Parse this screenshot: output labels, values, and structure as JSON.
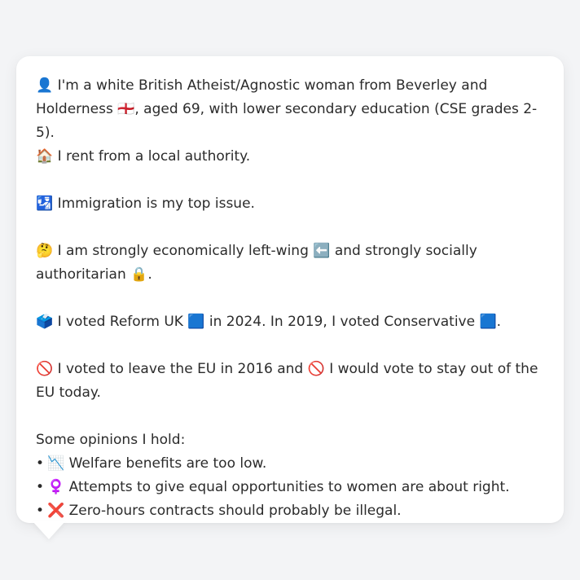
{
  "profile": {
    "intro": {
      "person_icon": "👤",
      "text_a": " I'm a white British Atheist/Agnostic woman from Beverley and Holderness ",
      "flag_icon": "🏴󠁧󠁢󠁥󠁮󠁧󠁿",
      "text_b": ", aged 69, with lower secondary education (CSE grades 2-5)."
    },
    "housing": {
      "house_icon": "🏠",
      "text": " I rent from a local authority."
    },
    "top_issue": {
      "icon": "🛂",
      "text": " Immigration is my top issue."
    },
    "ideology": {
      "thinking_icon": "🤔",
      "text_a": " I am strongly economically left-wing ",
      "left_arrow_icon": "⬅️",
      "text_b": " and strongly socially authoritarian ",
      "lock_icon": "🔒",
      "text_c": "."
    },
    "voting": {
      "ballot_icon": "🗳️",
      "text_a": " I voted Reform UK ",
      "reform_square": "🟦",
      "text_b": " in 2024. In 2019, I voted Conservative ",
      "conservative_square": "🟦",
      "text_c": "."
    },
    "brexit": {
      "no_icon_1": "🚫",
      "text_a": " I voted to leave the EU in 2016 and ",
      "no_icon_2": "🚫",
      "text_b": " I would vote to stay out of the EU today."
    },
    "opinions": {
      "heading": "Some opinions I hold:",
      "bullet": "•",
      "items": [
        {
          "icon": "📉",
          "text": " Welfare benefits are too low."
        },
        {
          "icon": "♀️",
          "text": " Attempts to give equal opportunities to women are about right."
        },
        {
          "icon": "❌",
          "text": " Zero-hours contracts should probably be illegal."
        }
      ]
    }
  }
}
